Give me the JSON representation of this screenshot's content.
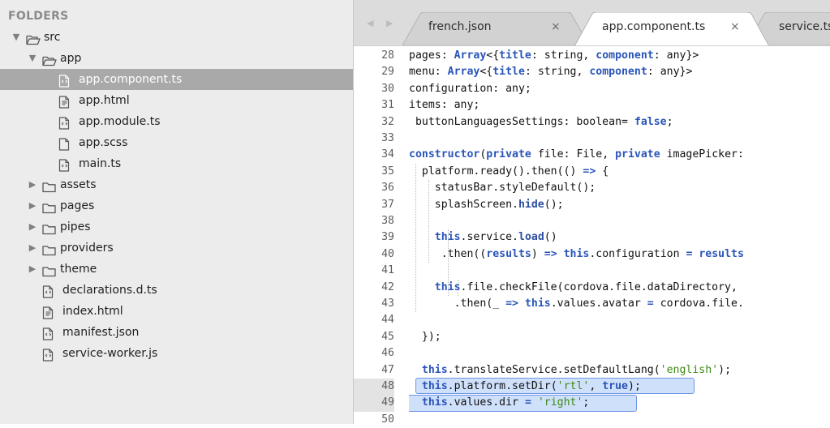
{
  "sidebar": {
    "header": "FOLDERS",
    "items": [
      {
        "label": "src",
        "type": "folder-open",
        "expanded": true,
        "icon": "folder-open-icon"
      },
      {
        "label": "app",
        "type": "folder-open",
        "expanded": true,
        "icon": "folder-open-icon"
      },
      {
        "label": "app.component.ts",
        "type": "file",
        "icon": "code-file-icon",
        "selected": true
      },
      {
        "label": "app.html",
        "type": "file",
        "icon": "markup-file-icon"
      },
      {
        "label": "app.module.ts",
        "type": "file",
        "icon": "code-file-icon"
      },
      {
        "label": "app.scss",
        "type": "file",
        "icon": "blank-file-icon"
      },
      {
        "label": "main.ts",
        "type": "file",
        "icon": "code-file-icon"
      },
      {
        "label": "assets",
        "type": "folder",
        "expanded": false,
        "icon": "folder-icon"
      },
      {
        "label": "pages",
        "type": "folder",
        "expanded": false,
        "icon": "folder-icon"
      },
      {
        "label": "pipes",
        "type": "folder",
        "expanded": false,
        "icon": "folder-icon"
      },
      {
        "label": "providers",
        "type": "folder",
        "expanded": false,
        "icon": "folder-icon"
      },
      {
        "label": "theme",
        "type": "folder",
        "expanded": false,
        "icon": "folder-icon"
      },
      {
        "label": "declarations.d.ts",
        "type": "file",
        "icon": "code-file-icon"
      },
      {
        "label": "index.html",
        "type": "file",
        "icon": "markup-file-icon"
      },
      {
        "label": "manifest.json",
        "type": "file",
        "icon": "code-file-icon"
      },
      {
        "label": "service-worker.js",
        "type": "file",
        "icon": "code-file-icon"
      }
    ]
  },
  "tabs": [
    {
      "label": "french.json",
      "close": "×",
      "active": false
    },
    {
      "label": "app.component.ts",
      "close": "×",
      "active": true
    },
    {
      "label": "service.ts",
      "close": "",
      "active": false
    }
  ],
  "colors": {
    "sidebar_bg": "#ececec",
    "selected_row": "#a9a9a9",
    "keyword": "#2a55b9",
    "string": "#3d8a15",
    "selection_fill": "#cfe0fb",
    "selection_border": "#6e95e6"
  },
  "code": {
    "selected_lines": [
      48,
      49
    ],
    "lines": [
      {
        "n": "28",
        "tokens": [
          [
            "",
            "pages: "
          ],
          [
            "kw",
            "Array"
          ],
          [
            "",
            "<{"
          ],
          [
            "kw",
            "title"
          ],
          [
            "",
            ": string, "
          ],
          [
            "kw",
            "component"
          ],
          [
            "",
            ": any}>"
          ]
        ]
      },
      {
        "n": "29",
        "tokens": [
          [
            "",
            "menu: "
          ],
          [
            "kw",
            "Array"
          ],
          [
            "",
            "<{"
          ],
          [
            "kw",
            "title"
          ],
          [
            "",
            ": string, "
          ],
          [
            "kw",
            "component"
          ],
          [
            "",
            ": any}>"
          ]
        ]
      },
      {
        "n": "30",
        "tokens": [
          [
            "",
            "configuration: any;"
          ]
        ]
      },
      {
        "n": "31",
        "tokens": [
          [
            "",
            "items: any;"
          ]
        ]
      },
      {
        "n": "32",
        "tokens": [
          [
            "",
            " buttonLanguagesSettings: boolean= "
          ],
          [
            "kw",
            "false"
          ],
          [
            "",
            ";"
          ]
        ]
      },
      {
        "n": "33",
        "tokens": []
      },
      {
        "n": "34",
        "tokens": [
          [
            "kw",
            "constructor"
          ],
          [
            "",
            "("
          ],
          [
            "kw",
            "private"
          ],
          [
            "",
            " file: File, "
          ],
          [
            "kw",
            "private"
          ],
          [
            "",
            " imagePicker:"
          ]
        ]
      },
      {
        "n": "35",
        "tokens": [
          [
            "",
            "  platform.ready().then(() "
          ],
          [
            "kw",
            "=>"
          ],
          [
            "",
            " {"
          ]
        ]
      },
      {
        "n": "36",
        "tokens": [
          [
            "",
            "    statusBar.styleDefault();"
          ]
        ]
      },
      {
        "n": "37",
        "tokens": [
          [
            "",
            "    splashScreen."
          ],
          [
            "fn",
            "hide"
          ],
          [
            "",
            "();"
          ]
        ]
      },
      {
        "n": "38",
        "tokens": []
      },
      {
        "n": "39",
        "tokens": [
          [
            "",
            "    "
          ],
          [
            "kw",
            "this"
          ],
          [
            "",
            ".service."
          ],
          [
            "fn",
            "load"
          ],
          [
            "",
            "()"
          ]
        ]
      },
      {
        "n": "40",
        "tokens": [
          [
            "",
            "     .then(("
          ],
          [
            "kw",
            "results"
          ],
          [
            "",
            ") "
          ],
          [
            "kw",
            "=>"
          ],
          [
            "",
            " "
          ],
          [
            "kw",
            "this"
          ],
          [
            "",
            ".configuration "
          ],
          [
            "kw",
            "="
          ],
          [
            "",
            " "
          ],
          [
            "kw",
            "results"
          ]
        ]
      },
      {
        "n": "41",
        "tokens": []
      },
      {
        "n": "42",
        "tokens": [
          [
            "",
            "    "
          ],
          [
            "kw",
            "this"
          ],
          [
            "",
            ".file.checkFile(cordova.file.dataDirectory,"
          ]
        ]
      },
      {
        "n": "43",
        "tokens": [
          [
            "",
            "       .then(_ "
          ],
          [
            "kw",
            "=>"
          ],
          [
            "",
            " "
          ],
          [
            "kw",
            "this"
          ],
          [
            "",
            ".values.avatar "
          ],
          [
            "kw",
            "="
          ],
          [
            "",
            " cordova.file."
          ]
        ]
      },
      {
        "n": "44",
        "tokens": []
      },
      {
        "n": "45",
        "tokens": [
          [
            "",
            "  });"
          ]
        ]
      },
      {
        "n": "46",
        "tokens": []
      },
      {
        "n": "47",
        "tokens": [
          [
            "",
            "  "
          ],
          [
            "kw",
            "this"
          ],
          [
            "",
            ".translateService.setDefaultLang("
          ],
          [
            "str",
            "'english'"
          ],
          [
            "",
            ");"
          ]
        ]
      },
      {
        "n": "48",
        "tokens": [
          [
            "",
            "  "
          ],
          [
            "kw",
            "this"
          ],
          [
            "",
            ".platform.setDir("
          ],
          [
            "str",
            "'rtl'"
          ],
          [
            "",
            ", "
          ],
          [
            "kw",
            "true"
          ],
          [
            "",
            ");"
          ]
        ]
      },
      {
        "n": "49",
        "tokens": [
          [
            "",
            "  "
          ],
          [
            "kw",
            "this"
          ],
          [
            "",
            ".values.dir "
          ],
          [
            "kw",
            "="
          ],
          [
            "",
            " "
          ],
          [
            "str",
            "'right'"
          ],
          [
            "",
            ";"
          ]
        ]
      },
      {
        "n": "50",
        "tokens": []
      }
    ]
  }
}
